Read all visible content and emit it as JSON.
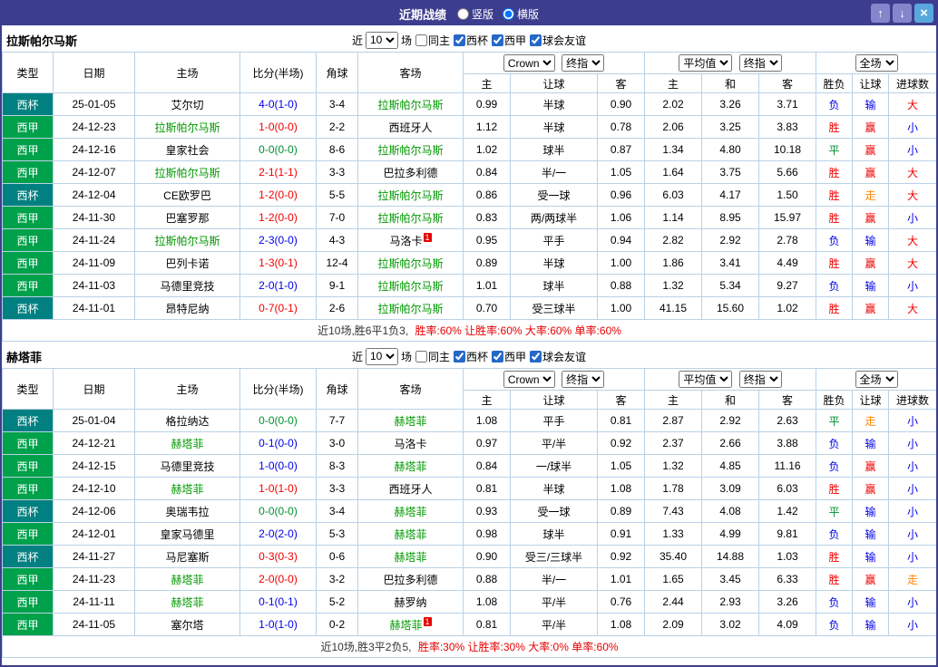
{
  "titlebar": {
    "title": "近期战绩",
    "radio_vertical": "竖版",
    "radio_horizontal": "横版",
    "selected_layout": "横版",
    "up_icon": "↑",
    "down_icon": "↓",
    "close_icon": "×"
  },
  "ui": {
    "near_label": "近",
    "match_count": "10",
    "games_label": "场",
    "same_home_label": "同主",
    "leagues": [
      "西杯",
      "西甲",
      "球会友谊"
    ],
    "columns": [
      "类型",
      "日期",
      "主场",
      "比分(半场)",
      "角球",
      "客场"
    ],
    "odds_source": "Crown",
    "odds_type": "终指",
    "avg_label": "平均值",
    "scope_label": "全场",
    "sub_columns": [
      "主",
      "让球",
      "客",
      "主",
      "和",
      "客",
      "胜负",
      "让球",
      "进球数"
    ]
  },
  "colors": {
    "titlebar": "#3d3d8f",
    "league_cup": "#008080",
    "league_liga": "#00a14b",
    "win": "#f00000",
    "loss": "#0000e8",
    "draw": "#009030",
    "push": "#ff8800",
    "focus_team": "#009900",
    "table_border": "#b9d1e6"
  },
  "sections": [
    {
      "team": "拉斯帕尔马斯",
      "summary_prefix": "近10场,胜6平1负3,",
      "summary_stats": "胜率:60% 让胜率:60% 大率:60% 单率:60%",
      "rows": [
        {
          "league": "西杯",
          "lg": "cup",
          "date": "25-01-05",
          "home": "艾尔切",
          "hf": false,
          "score": "4-0(1-0)",
          "sc": "loss",
          "corner": "3-4",
          "away": "拉斯帕尔马斯",
          "af": true,
          "o1": "0.99",
          "h": "半球",
          "o2": "0.90",
          "a1": "2.02",
          "a2": "3.26",
          "a3": "3.71",
          "w": "负",
          "wc": "loss",
          "hd": "输",
          "hdc": "loss",
          "ou": "大",
          "ouc": "win"
        },
        {
          "league": "西甲",
          "lg": "liga",
          "date": "24-12-23",
          "home": "拉斯帕尔马斯",
          "hf": true,
          "score": "1-0(0-0)",
          "sc": "win",
          "corner": "2-2",
          "away": "西班牙人",
          "af": false,
          "o1": "1.12",
          "h": "半球",
          "o2": "0.78",
          "a1": "2.06",
          "a2": "3.25",
          "a3": "3.83",
          "w": "胜",
          "wc": "win",
          "hd": "赢",
          "hdc": "win",
          "ou": "小",
          "ouc": "loss"
        },
        {
          "league": "西甲",
          "lg": "liga",
          "date": "24-12-16",
          "home": "皇家社会",
          "hf": false,
          "score": "0-0(0-0)",
          "sc": "draw",
          "corner": "8-6",
          "away": "拉斯帕尔马斯",
          "af": true,
          "o1": "1.02",
          "h": "球半",
          "o2": "0.87",
          "a1": "1.34",
          "a2": "4.80",
          "a3": "10.18",
          "w": "平",
          "wc": "draw",
          "hd": "赢",
          "hdc": "win",
          "ou": "小",
          "ouc": "loss"
        },
        {
          "league": "西甲",
          "lg": "liga",
          "date": "24-12-07",
          "home": "拉斯帕尔马斯",
          "hf": true,
          "score": "2-1(1-1)",
          "sc": "win",
          "corner": "3-3",
          "away": "巴拉多利德",
          "af": false,
          "o1": "0.84",
          "h": "半/一",
          "o2": "1.05",
          "a1": "1.64",
          "a2": "3.75",
          "a3": "5.66",
          "w": "胜",
          "wc": "win",
          "hd": "赢",
          "hdc": "win",
          "ou": "大",
          "ouc": "win"
        },
        {
          "league": "西杯",
          "lg": "cup",
          "date": "24-12-04",
          "home": "CE欧罗巴",
          "hf": false,
          "score": "1-2(0-0)",
          "sc": "win",
          "corner": "5-5",
          "away": "拉斯帕尔马斯",
          "af": true,
          "o1": "0.86",
          "h": "受一球",
          "o2": "0.96",
          "a1": "6.03",
          "a2": "4.17",
          "a3": "1.50",
          "w": "胜",
          "wc": "win",
          "hd": "走",
          "hdc": "push",
          "ou": "大",
          "ouc": "win"
        },
        {
          "league": "西甲",
          "lg": "liga",
          "date": "24-11-30",
          "home": "巴塞罗那",
          "hf": false,
          "score": "1-2(0-0)",
          "sc": "win",
          "corner": "7-0",
          "away": "拉斯帕尔马斯",
          "af": true,
          "o1": "0.83",
          "h": "两/两球半",
          "o2": "1.06",
          "a1": "1.14",
          "a2": "8.95",
          "a3": "15.97",
          "w": "胜",
          "wc": "win",
          "hd": "赢",
          "hdc": "win",
          "ou": "小",
          "ouc": "loss"
        },
        {
          "league": "西甲",
          "lg": "liga",
          "date": "24-11-24",
          "home": "拉斯帕尔马斯",
          "hf": true,
          "score": "2-3(0-0)",
          "sc": "loss",
          "corner": "4-3",
          "away": "马洛卡",
          "af": false,
          "acard": "1",
          "o1": "0.95",
          "h": "平手",
          "o2": "0.94",
          "a1": "2.82",
          "a2": "2.92",
          "a3": "2.78",
          "w": "负",
          "wc": "loss",
          "hd": "输",
          "hdc": "loss",
          "ou": "大",
          "ouc": "win"
        },
        {
          "league": "西甲",
          "lg": "liga",
          "date": "24-11-09",
          "home": "巴列卡诺",
          "hf": false,
          "score": "1-3(0-1)",
          "sc": "win",
          "corner": "12-4",
          "away": "拉斯帕尔马斯",
          "af": true,
          "o1": "0.89",
          "h": "半球",
          "o2": "1.00",
          "a1": "1.86",
          "a2": "3.41",
          "a3": "4.49",
          "w": "胜",
          "wc": "win",
          "hd": "赢",
          "hdc": "win",
          "ou": "大",
          "ouc": "win"
        },
        {
          "league": "西甲",
          "lg": "liga",
          "date": "24-11-03",
          "home": "马德里竞技",
          "hf": false,
          "score": "2-0(1-0)",
          "sc": "loss",
          "corner": "9-1",
          "away": "拉斯帕尔马斯",
          "af": true,
          "o1": "1.01",
          "h": "球半",
          "o2": "0.88",
          "a1": "1.32",
          "a2": "5.34",
          "a3": "9.27",
          "w": "负",
          "wc": "loss",
          "hd": "输",
          "hdc": "loss",
          "ou": "小",
          "ouc": "loss"
        },
        {
          "league": "西杯",
          "lg": "cup",
          "date": "24-11-01",
          "home": "昂特尼纳",
          "hf": false,
          "score": "0-7(0-1)",
          "sc": "win",
          "corner": "2-6",
          "away": "拉斯帕尔马斯",
          "af": true,
          "o1": "0.70",
          "h": "受三球半",
          "o2": "1.00",
          "a1": "41.15",
          "a2": "15.60",
          "a3": "1.02",
          "w": "胜",
          "wc": "win",
          "hd": "赢",
          "hdc": "win",
          "ou": "大",
          "ouc": "win"
        }
      ]
    },
    {
      "team": "赫塔菲",
      "summary_prefix": "近10场,胜3平2负5,",
      "summary_stats": "胜率:30% 让胜率:30% 大率:0% 单率:60%",
      "rows": [
        {
          "league": "西杯",
          "lg": "cup",
          "date": "25-01-04",
          "home": "格拉纳达",
          "hf": false,
          "score": "0-0(0-0)",
          "sc": "draw",
          "corner": "7-7",
          "away": "赫塔菲",
          "af": true,
          "o1": "1.08",
          "h": "平手",
          "o2": "0.81",
          "a1": "2.87",
          "a2": "2.92",
          "a3": "2.63",
          "w": "平",
          "wc": "draw",
          "hd": "走",
          "hdc": "push",
          "ou": "小",
          "ouc": "loss"
        },
        {
          "league": "西甲",
          "lg": "liga",
          "date": "24-12-21",
          "home": "赫塔菲",
          "hf": true,
          "score": "0-1(0-0)",
          "sc": "loss",
          "corner": "3-0",
          "away": "马洛卡",
          "af": false,
          "o1": "0.97",
          "h": "平/半",
          "o2": "0.92",
          "a1": "2.37",
          "a2": "2.66",
          "a3": "3.88",
          "w": "负",
          "wc": "loss",
          "hd": "输",
          "hdc": "loss",
          "ou": "小",
          "ouc": "loss"
        },
        {
          "league": "西甲",
          "lg": "liga",
          "date": "24-12-15",
          "home": "马德里竞技",
          "hf": false,
          "score": "1-0(0-0)",
          "sc": "loss",
          "corner": "8-3",
          "away": "赫塔菲",
          "af": true,
          "o1": "0.84",
          "h": "一/球半",
          "o2": "1.05",
          "a1": "1.32",
          "a2": "4.85",
          "a3": "11.16",
          "w": "负",
          "wc": "loss",
          "hd": "赢",
          "hdc": "win",
          "ou": "小",
          "ouc": "loss"
        },
        {
          "league": "西甲",
          "lg": "liga",
          "date": "24-12-10",
          "home": "赫塔菲",
          "hf": true,
          "score": "1-0(1-0)",
          "sc": "win",
          "corner": "3-3",
          "away": "西班牙人",
          "af": false,
          "o1": "0.81",
          "h": "半球",
          "o2": "1.08",
          "a1": "1.78",
          "a2": "3.09",
          "a3": "6.03",
          "w": "胜",
          "wc": "win",
          "hd": "赢",
          "hdc": "win",
          "ou": "小",
          "ouc": "loss"
        },
        {
          "league": "西杯",
          "lg": "cup",
          "date": "24-12-06",
          "home": "奥瑞韦拉",
          "hf": false,
          "score": "0-0(0-0)",
          "sc": "draw",
          "corner": "3-4",
          "away": "赫塔菲",
          "af": true,
          "o1": "0.93",
          "h": "受一球",
          "o2": "0.89",
          "a1": "7.43",
          "a2": "4.08",
          "a3": "1.42",
          "w": "平",
          "wc": "draw",
          "hd": "输",
          "hdc": "loss",
          "ou": "小",
          "ouc": "loss"
        },
        {
          "league": "西甲",
          "lg": "liga",
          "date": "24-12-01",
          "home": "皇家马德里",
          "hf": false,
          "score": "2-0(2-0)",
          "sc": "loss",
          "corner": "5-3",
          "away": "赫塔菲",
          "af": true,
          "o1": "0.98",
          "h": "球半",
          "o2": "0.91",
          "a1": "1.33",
          "a2": "4.99",
          "a3": "9.81",
          "w": "负",
          "wc": "loss",
          "hd": "输",
          "hdc": "loss",
          "ou": "小",
          "ouc": "loss"
        },
        {
          "league": "西杯",
          "lg": "cup",
          "date": "24-11-27",
          "home": "马尼塞斯",
          "hf": false,
          "score": "0-3(0-3)",
          "sc": "win",
          "corner": "0-6",
          "away": "赫塔菲",
          "af": true,
          "o1": "0.90",
          "h": "受三/三球半",
          "o2": "0.92",
          "a1": "35.40",
          "a2": "14.88",
          "a3": "1.03",
          "w": "胜",
          "wc": "win",
          "hd": "输",
          "hdc": "loss",
          "ou": "小",
          "ouc": "loss"
        },
        {
          "league": "西甲",
          "lg": "liga",
          "date": "24-11-23",
          "home": "赫塔菲",
          "hf": true,
          "score": "2-0(0-0)",
          "sc": "win",
          "corner": "3-2",
          "away": "巴拉多利德",
          "af": false,
          "o1": "0.88",
          "h": "半/一",
          "o2": "1.01",
          "a1": "1.65",
          "a2": "3.45",
          "a3": "6.33",
          "w": "胜",
          "wc": "win",
          "hd": "赢",
          "hdc": "win",
          "ou": "走",
          "ouc": "push"
        },
        {
          "league": "西甲",
          "lg": "liga",
          "date": "24-11-11",
          "home": "赫塔菲",
          "hf": true,
          "score": "0-1(0-1)",
          "sc": "loss",
          "corner": "5-2",
          "away": "赫罗纳",
          "af": false,
          "o1": "1.08",
          "h": "平/半",
          "o2": "0.76",
          "a1": "2.44",
          "a2": "2.93",
          "a3": "3.26",
          "w": "负",
          "wc": "loss",
          "hd": "输",
          "hdc": "loss",
          "ou": "小",
          "ouc": "loss"
        },
        {
          "league": "西甲",
          "lg": "liga",
          "date": "24-11-05",
          "home": "塞尔塔",
          "hf": false,
          "score": "1-0(1-0)",
          "sc": "loss",
          "corner": "0-2",
          "away": "赫塔菲",
          "af": true,
          "acard": "1",
          "o1": "0.81",
          "h": "平/半",
          "o2": "1.08",
          "a1": "2.09",
          "a2": "3.02",
          "a3": "4.09",
          "w": "负",
          "wc": "loss",
          "hd": "输",
          "hdc": "loss",
          "ou": "小",
          "ouc": "loss"
        }
      ]
    }
  ]
}
